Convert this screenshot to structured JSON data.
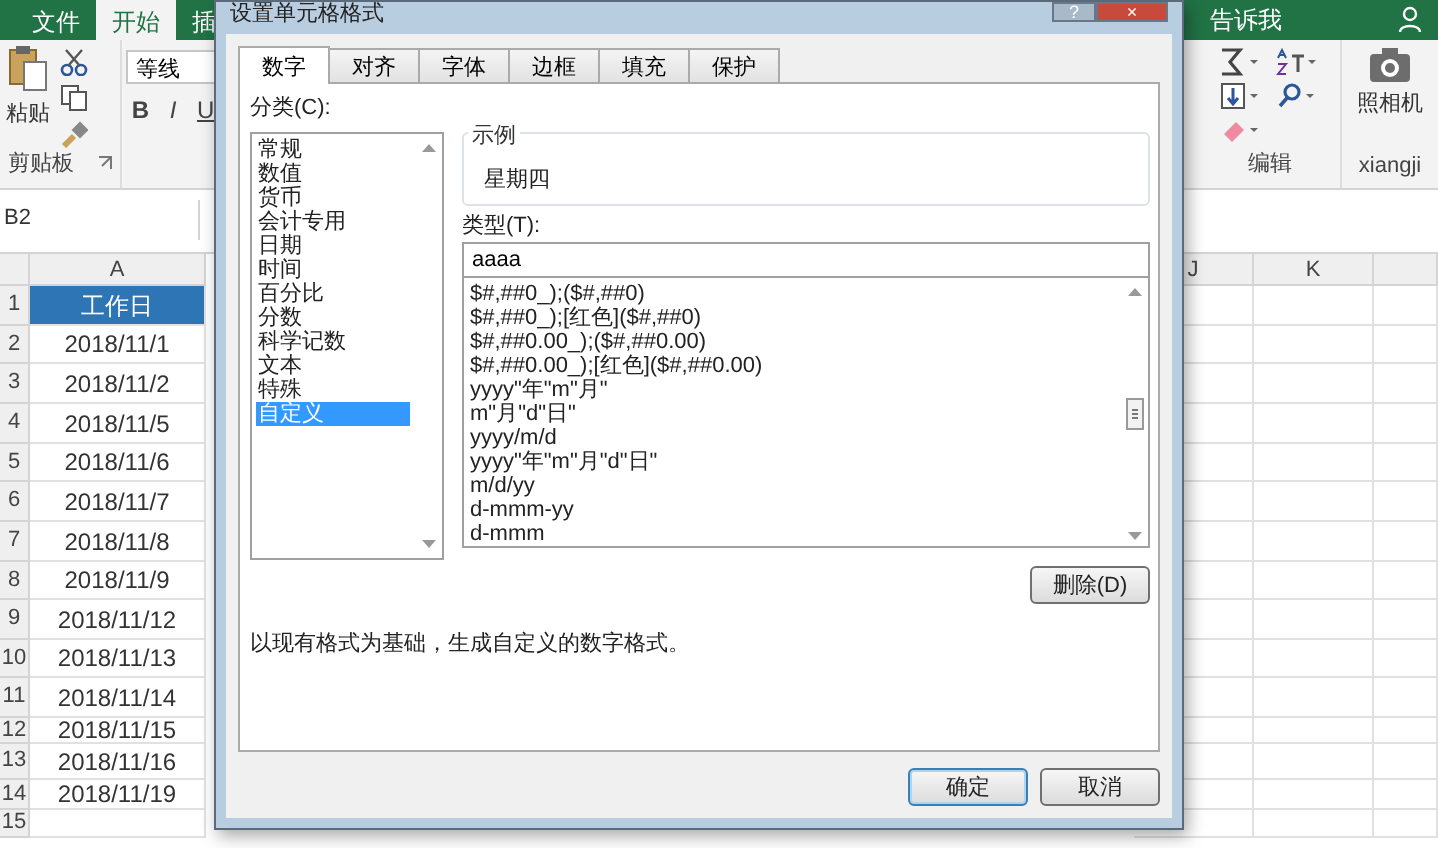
{
  "excel": {
    "ribbon_tabs": [
      {
        "label": "文件",
        "selected": false
      },
      {
        "label": "开始",
        "selected": true
      },
      {
        "label": "插",
        "selected": false
      }
    ],
    "tell_me": "告诉我",
    "clipboard": {
      "paste": "粘贴",
      "group": "剪贴板"
    },
    "font": {
      "name": "等线",
      "bold": "B",
      "italic": "I",
      "underline": "U"
    },
    "editing": {
      "group": "编辑"
    },
    "camera": {
      "label": "照相机",
      "group": "xiangji"
    },
    "name_box": "B2",
    "columns": [
      "A",
      "J",
      "K"
    ],
    "rows": [
      {
        "number": "1",
        "cell": "工作日",
        "kind": "header"
      },
      {
        "number": "2",
        "cell": "2018/11/1",
        "kind": "date"
      },
      {
        "number": "3",
        "cell": "2018/11/2",
        "kind": "date"
      },
      {
        "number": "4",
        "cell": "2018/11/5",
        "kind": "date"
      },
      {
        "number": "5",
        "cell": "2018/11/6",
        "kind": "date"
      },
      {
        "number": "6",
        "cell": "2018/11/7",
        "kind": "date"
      },
      {
        "number": "7",
        "cell": "2018/11/8",
        "kind": "date"
      },
      {
        "number": "8",
        "cell": "2018/11/9",
        "kind": "date"
      },
      {
        "number": "9",
        "cell": "2018/11/12",
        "kind": "date"
      },
      {
        "number": "10",
        "cell": "2018/11/13",
        "kind": "date"
      },
      {
        "number": "11",
        "cell": "2018/11/14",
        "kind": "date"
      },
      {
        "number": "12",
        "cell": "2018/11/15",
        "kind": "date"
      },
      {
        "number": "13",
        "cell": "2018/11/16",
        "kind": "date"
      },
      {
        "number": "14",
        "cell": "2018/11/19",
        "kind": "date"
      },
      {
        "number": "15",
        "kind": "empty"
      }
    ]
  },
  "dialog": {
    "title": "设置单元格格式",
    "help_button": "?",
    "close_button": "×",
    "tabs": [
      {
        "label": "数字",
        "selected": true
      },
      {
        "label": "对齐",
        "selected": false
      },
      {
        "label": "字体",
        "selected": false
      },
      {
        "label": "边框",
        "selected": false
      },
      {
        "label": "填充",
        "selected": false
      },
      {
        "label": "保护",
        "selected": false
      }
    ],
    "category_label": "分类(C):",
    "categories": [
      {
        "label": "常规",
        "selected": false
      },
      {
        "label": "数值",
        "selected": false
      },
      {
        "label": "货币",
        "selected": false
      },
      {
        "label": "会计专用",
        "selected": false
      },
      {
        "label": "日期",
        "selected": false
      },
      {
        "label": "时间",
        "selected": false
      },
      {
        "label": "百分比",
        "selected": false
      },
      {
        "label": "分数",
        "selected": false
      },
      {
        "label": "科学记数",
        "selected": false
      },
      {
        "label": "文本",
        "selected": false
      },
      {
        "label": "特殊",
        "selected": false
      },
      {
        "label": "自定义",
        "selected": true
      }
    ],
    "sample_label": "示例",
    "sample": "星期四",
    "type_label": "类型(T):",
    "type_value": "aaaa",
    "formats": [
      "$#,##0_);($#,##0)",
      "$#,##0_);[红色]($#,##0)",
      "$#,##0.00_);($#,##0.00)",
      "$#,##0.00_);[红色]($#,##0.00)",
      "yyyy\"年\"m\"月\"",
      "m\"月\"d\"日\"",
      "yyyy/m/d",
      "yyyy\"年\"m\"月\"d\"日\"",
      "m/d/yy",
      "d-mmm-yy",
      "d-mmm"
    ],
    "delete_button": "删除(D)",
    "description": "以现有格式为基础，生成自定义的数字格式。",
    "ok_button": "确定",
    "cancel_button": "取消"
  }
}
